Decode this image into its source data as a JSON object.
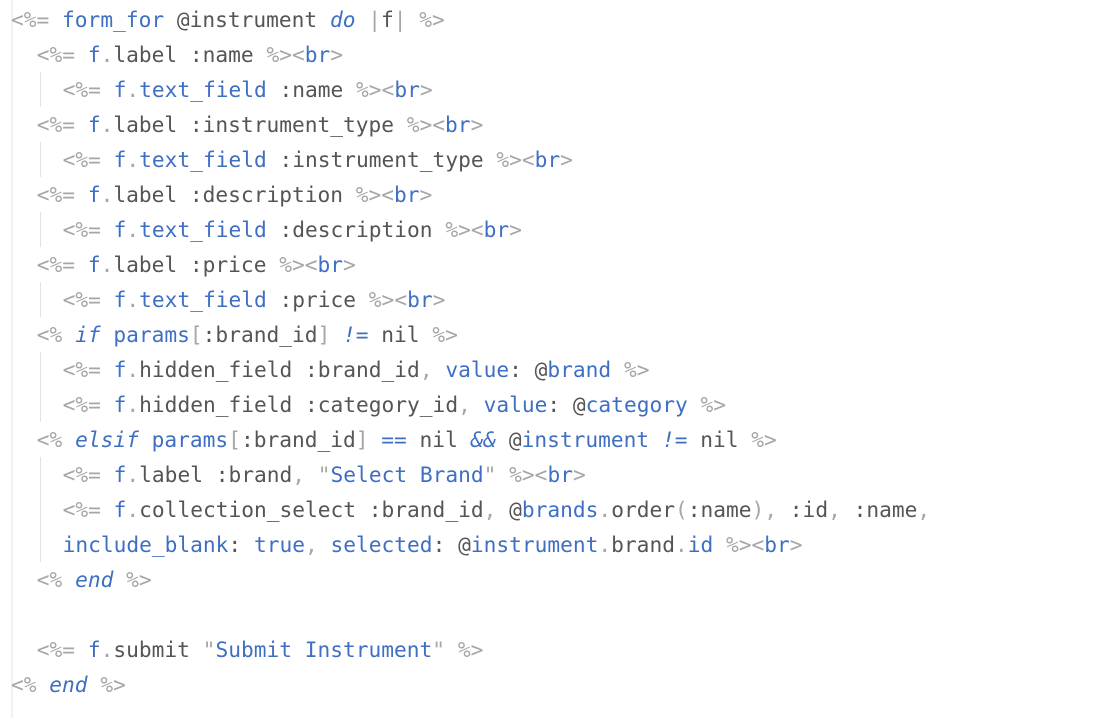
{
  "theme": {
    "background": "#ffffff",
    "plain_text": "#555555",
    "dim_text": "#a6a6a6",
    "keyword_blue": "#3f6fc3"
  },
  "code_lines": [
    {
      "indent": 0,
      "tokens": [
        [
          "<%=",
          "d"
        ],
        [
          " ",
          "i"
        ],
        [
          "form_for",
          "b"
        ],
        [
          " @instrument ",
          "i"
        ],
        [
          "do",
          "bi"
        ],
        [
          " ",
          "i"
        ],
        [
          "|",
          "d"
        ],
        [
          "f",
          "i"
        ],
        [
          "|",
          "d"
        ],
        [
          " ",
          "i"
        ],
        [
          "%>",
          "d"
        ]
      ]
    },
    {
      "indent": 1,
      "tokens": [
        [
          "<%=",
          "d"
        ],
        [
          " ",
          "i"
        ],
        [
          "f",
          "b"
        ],
        [
          ".",
          "d"
        ],
        [
          "label :name ",
          "i"
        ],
        [
          "%>",
          "d"
        ],
        [
          "<",
          "d"
        ],
        [
          "br",
          "b"
        ],
        [
          ">",
          "d"
        ]
      ]
    },
    {
      "indent": 2,
      "tokens": [
        [
          "<%=",
          "d"
        ],
        [
          " ",
          "i"
        ],
        [
          "f",
          "b"
        ],
        [
          ".",
          "d"
        ],
        [
          "text_field",
          "b"
        ],
        [
          " :name ",
          "i"
        ],
        [
          "%>",
          "d"
        ],
        [
          "<",
          "d"
        ],
        [
          "br",
          "b"
        ],
        [
          ">",
          "d"
        ]
      ]
    },
    {
      "indent": 1,
      "tokens": [
        [
          "<%=",
          "d"
        ],
        [
          " ",
          "i"
        ],
        [
          "f",
          "b"
        ],
        [
          ".",
          "d"
        ],
        [
          "label :instrument_type ",
          "i"
        ],
        [
          "%>",
          "d"
        ],
        [
          "<",
          "d"
        ],
        [
          "br",
          "b"
        ],
        [
          ">",
          "d"
        ]
      ]
    },
    {
      "indent": 2,
      "tokens": [
        [
          "<%=",
          "d"
        ],
        [
          " ",
          "i"
        ],
        [
          "f",
          "b"
        ],
        [
          ".",
          "d"
        ],
        [
          "text_field",
          "b"
        ],
        [
          " :instrument_type ",
          "i"
        ],
        [
          "%>",
          "d"
        ],
        [
          "<",
          "d"
        ],
        [
          "br",
          "b"
        ],
        [
          ">",
          "d"
        ]
      ]
    },
    {
      "indent": 1,
      "tokens": [
        [
          "<%=",
          "d"
        ],
        [
          " ",
          "i"
        ],
        [
          "f",
          "b"
        ],
        [
          ".",
          "d"
        ],
        [
          "label :description ",
          "i"
        ],
        [
          "%>",
          "d"
        ],
        [
          "<",
          "d"
        ],
        [
          "br",
          "b"
        ],
        [
          ">",
          "d"
        ]
      ]
    },
    {
      "indent": 2,
      "tokens": [
        [
          "<%=",
          "d"
        ],
        [
          " ",
          "i"
        ],
        [
          "f",
          "b"
        ],
        [
          ".",
          "d"
        ],
        [
          "text_field",
          "b"
        ],
        [
          " :description ",
          "i"
        ],
        [
          "%>",
          "d"
        ],
        [
          "<",
          "d"
        ],
        [
          "br",
          "b"
        ],
        [
          ">",
          "d"
        ]
      ]
    },
    {
      "indent": 1,
      "tokens": [
        [
          "<%=",
          "d"
        ],
        [
          " ",
          "i"
        ],
        [
          "f",
          "b"
        ],
        [
          ".",
          "d"
        ],
        [
          "label :price ",
          "i"
        ],
        [
          "%>",
          "d"
        ],
        [
          "<",
          "d"
        ],
        [
          "br",
          "b"
        ],
        [
          ">",
          "d"
        ]
      ]
    },
    {
      "indent": 2,
      "tokens": [
        [
          "<%=",
          "d"
        ],
        [
          " ",
          "i"
        ],
        [
          "f",
          "b"
        ],
        [
          ".",
          "d"
        ],
        [
          "text_field",
          "b"
        ],
        [
          " :price ",
          "i"
        ],
        [
          "%>",
          "d"
        ],
        [
          "<",
          "d"
        ],
        [
          "br",
          "b"
        ],
        [
          ">",
          "d"
        ]
      ]
    },
    {
      "indent": 1,
      "tokens": [
        [
          "<%",
          "d"
        ],
        [
          " ",
          "i"
        ],
        [
          "if",
          "bi"
        ],
        [
          " ",
          "i"
        ],
        [
          "params",
          "b"
        ],
        [
          "[",
          "d"
        ],
        [
          ":brand_id",
          "i"
        ],
        [
          "]",
          "d"
        ],
        [
          " ",
          "i"
        ],
        [
          "!=",
          "bi"
        ],
        [
          " nil ",
          "i"
        ],
        [
          "%>",
          "d"
        ]
      ]
    },
    {
      "indent": 2,
      "tokens": [
        [
          "<%=",
          "d"
        ],
        [
          " ",
          "i"
        ],
        [
          "f",
          "b"
        ],
        [
          ".",
          "d"
        ],
        [
          "hidden_field :brand_id",
          "i"
        ],
        [
          ",",
          "d"
        ],
        [
          " ",
          "i"
        ],
        [
          "value",
          "b"
        ],
        [
          ": @",
          "i"
        ],
        [
          "brand",
          "b"
        ],
        [
          " ",
          "i"
        ],
        [
          "%>",
          "d"
        ]
      ]
    },
    {
      "indent": 2,
      "tokens": [
        [
          "<%=",
          "d"
        ],
        [
          " ",
          "i"
        ],
        [
          "f",
          "b"
        ],
        [
          ".",
          "d"
        ],
        [
          "hidden_field :category_id",
          "i"
        ],
        [
          ",",
          "d"
        ],
        [
          " ",
          "i"
        ],
        [
          "value",
          "b"
        ],
        [
          ": @",
          "i"
        ],
        [
          "category",
          "b"
        ],
        [
          " ",
          "i"
        ],
        [
          "%>",
          "d"
        ]
      ]
    },
    {
      "indent": 1,
      "tokens": [
        [
          "<%",
          "d"
        ],
        [
          " ",
          "i"
        ],
        [
          "elsif",
          "bi"
        ],
        [
          " ",
          "i"
        ],
        [
          "params",
          "b"
        ],
        [
          "[",
          "d"
        ],
        [
          ":brand_id",
          "i"
        ],
        [
          "]",
          "d"
        ],
        [
          " ",
          "i"
        ],
        [
          "==",
          "b"
        ],
        [
          " nil ",
          "i"
        ],
        [
          "&&",
          "bi"
        ],
        [
          " @",
          "i"
        ],
        [
          "instrument",
          "b"
        ],
        [
          " ",
          "i"
        ],
        [
          "!=",
          "bi"
        ],
        [
          " nil ",
          "i"
        ],
        [
          "%>",
          "d"
        ]
      ]
    },
    {
      "indent": 2,
      "tokens": [
        [
          "<%=",
          "d"
        ],
        [
          " ",
          "i"
        ],
        [
          "f",
          "b"
        ],
        [
          ".",
          "d"
        ],
        [
          "label :brand",
          "i"
        ],
        [
          ",",
          "d"
        ],
        [
          " ",
          "i"
        ],
        [
          "\"",
          "sq"
        ],
        [
          "Select Brand",
          "s"
        ],
        [
          "\"",
          "sq"
        ],
        [
          " ",
          "i"
        ],
        [
          "%>",
          "d"
        ],
        [
          "<",
          "d"
        ],
        [
          "br",
          "b"
        ],
        [
          ">",
          "d"
        ]
      ]
    },
    {
      "indent": 2,
      "tokens": [
        [
          "<%=",
          "d"
        ],
        [
          " ",
          "i"
        ],
        [
          "f",
          "b"
        ],
        [
          ".",
          "d"
        ],
        [
          "collection_select :brand_id",
          "i"
        ],
        [
          ",",
          "d"
        ],
        [
          " @",
          "i"
        ],
        [
          "brands",
          "b"
        ],
        [
          ".",
          "d"
        ],
        [
          "order",
          "i"
        ],
        [
          "(",
          "d"
        ],
        [
          ":name",
          "i"
        ],
        [
          ")",
          "d"
        ],
        [
          ",",
          "d"
        ],
        [
          " :id",
          "i"
        ],
        [
          ",",
          "d"
        ],
        [
          " :name",
          "i"
        ],
        [
          ",",
          "d"
        ]
      ]
    },
    {
      "indent": 2,
      "tokens": [
        [
          "include_blank",
          "b"
        ],
        [
          ": ",
          "i"
        ],
        [
          "true",
          "b"
        ],
        [
          ",",
          "d"
        ],
        [
          " ",
          "i"
        ],
        [
          "selected",
          "b"
        ],
        [
          ": @",
          "i"
        ],
        [
          "instrument",
          "b"
        ],
        [
          ".",
          "d"
        ],
        [
          "brand",
          "i"
        ],
        [
          ".",
          "d"
        ],
        [
          "id",
          "b"
        ],
        [
          " ",
          "i"
        ],
        [
          "%>",
          "d"
        ],
        [
          "<",
          "d"
        ],
        [
          "br",
          "b"
        ],
        [
          ">",
          "d"
        ]
      ]
    },
    {
      "indent": 1,
      "tokens": [
        [
          "<%",
          "d"
        ],
        [
          " ",
          "i"
        ],
        [
          "end",
          "bi"
        ],
        [
          " ",
          "i"
        ],
        [
          "%>",
          "d"
        ]
      ]
    },
    {
      "indent": 0,
      "tokens": []
    },
    {
      "indent": 1,
      "tokens": [
        [
          "<%=",
          "d"
        ],
        [
          " ",
          "i"
        ],
        [
          "f",
          "b"
        ],
        [
          ".",
          "d"
        ],
        [
          "submit ",
          "i"
        ],
        [
          "\"",
          "sq"
        ],
        [
          "Submit Instrument",
          "s"
        ],
        [
          "\"",
          "sq"
        ],
        [
          " ",
          "i"
        ],
        [
          "%>",
          "d"
        ]
      ]
    },
    {
      "indent": 0,
      "tokens": [
        [
          "<%",
          "d"
        ],
        [
          " ",
          "i"
        ],
        [
          "end",
          "bi"
        ],
        [
          " ",
          "i"
        ],
        [
          "%>",
          "d"
        ]
      ]
    }
  ]
}
